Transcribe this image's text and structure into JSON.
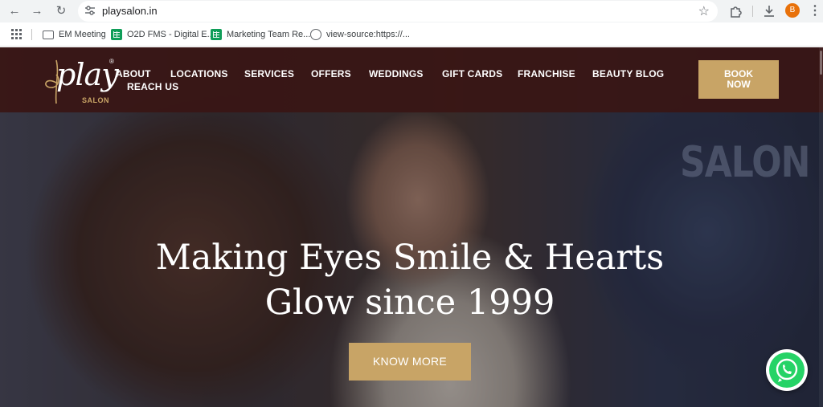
{
  "browser": {
    "url": "playsalon.in",
    "avatar_letter": "B",
    "bookmarks": [
      {
        "label": "EM Meeting",
        "icon": "folder-icon"
      },
      {
        "label": "O2D FMS - Digital E...",
        "icon": "sheets-icon"
      },
      {
        "label": "Marketing Team Re...",
        "icon": "sheets-icon"
      },
      {
        "label": "view-source:https://...",
        "icon": "globe-icon"
      }
    ],
    "icons": {
      "back": "back-arrow-icon",
      "forward": "forward-arrow-icon",
      "reload": "reload-icon",
      "site_info": "tune-icon",
      "bookmark_star": "star-icon",
      "extensions": "puzzle-icon",
      "downloads": "download-icon",
      "menu": "kebab-menu-icon",
      "apps": "apps-grid-icon"
    }
  },
  "site": {
    "logo": {
      "word": "play",
      "sub": "SALON",
      "mark": "®"
    },
    "nav": {
      "about": "ABOUT",
      "locations": "LOCATIONS",
      "services": "SERVICES",
      "offers": "OFFERS",
      "weddings": "WEDDINGS",
      "gift_cards": "GIFT CARDS",
      "franchise": "FRANCHISE",
      "beauty_blog": "BEAUTY BLOG",
      "reach_us": "REACH US"
    },
    "book_now": {
      "line1": "BOOK",
      "line2": "NOW"
    },
    "hero": {
      "line1": "Making Eyes Smile & Hearts",
      "line2": "Glow since 1999",
      "cta": "KNOW MORE",
      "background_sign": "SALON"
    },
    "whatsapp_icon": "whatsapp-icon",
    "colors": {
      "header_bg": "#391614",
      "gold": "#c8a466",
      "whatsapp_green": "#25d366"
    }
  }
}
